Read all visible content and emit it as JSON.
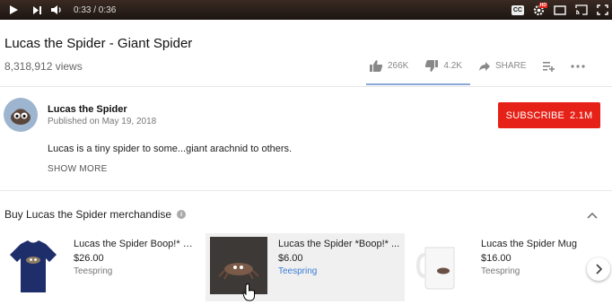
{
  "player": {
    "time": "0:33 / 0:36",
    "icons": [
      "play-icon",
      "next-icon",
      "volume-icon",
      "captions-icon",
      "settings-icon",
      "miniplayer-icon",
      "cast-icon",
      "fullscreen-icon"
    ],
    "captions_label": "CC",
    "hd_badge": "HD"
  },
  "video": {
    "title": "Lucas the Spider - Giant Spider",
    "views": "8,318,912 views"
  },
  "actions": {
    "likes": "266K",
    "dislikes": "4.2K",
    "share": "SHARE"
  },
  "channel": {
    "name": "Lucas the Spider",
    "published": "Published on May 19, 2018",
    "subscribe_label": "SUBSCRIBE",
    "subscriber_count": "2.1M",
    "description": "Lucas is a tiny spider to some...giant arachnid to others.",
    "show_more": "SHOW MORE"
  },
  "merch": {
    "title": "Buy Lucas the Spider merchandise",
    "info_icon": "i",
    "items": [
      {
        "name": "Lucas the Spider Boop!* S...",
        "price": "$26.00",
        "seller": "Teespring"
      },
      {
        "name": "Lucas the Spider *Boop!* ...",
        "price": "$6.00",
        "seller": "Teespring"
      },
      {
        "name": "Lucas the Spider Mug",
        "price": "$16.00",
        "seller": "Teespring"
      }
    ]
  },
  "colors": {
    "subscribe": "#e62117",
    "link": "#3a7bd5",
    "player_bar": "#1c1512"
  }
}
